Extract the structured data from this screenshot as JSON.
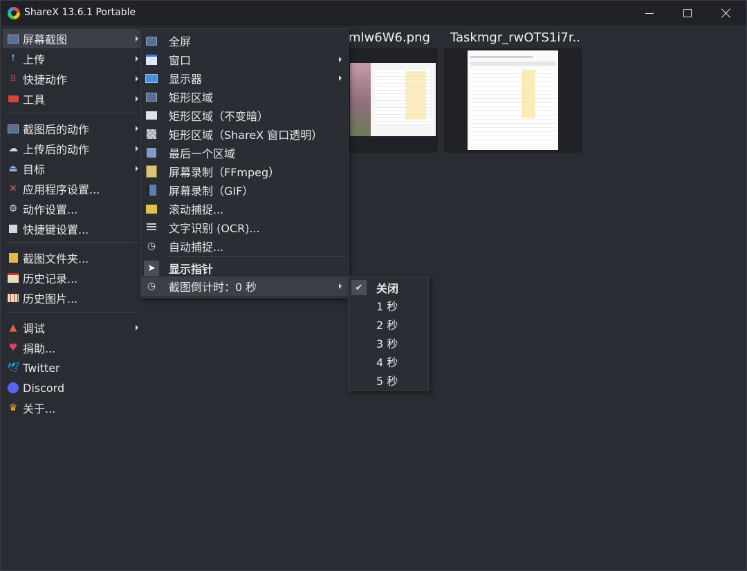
{
  "window": {
    "title": "ShareX 13.6.1 Portable"
  },
  "thumbnails": [
    {
      "title": "mlw6W6.png"
    },
    {
      "title": "Taskmgr_rwOTS1i7r..."
    }
  ],
  "main_menu": {
    "items": [
      {
        "label": "屏幕截图",
        "icon": "screenshot-icon",
        "has_submenu": true
      },
      {
        "label": "上传",
        "icon": "upload-arrow-icon",
        "has_submenu": true
      },
      {
        "label": "快捷动作",
        "icon": "quick-actions-grid-icon",
        "has_submenu": true
      },
      {
        "label": "工具",
        "icon": "toolbox-icon",
        "has_submenu": true
      },
      {
        "label": "截图后的动作",
        "icon": "after-capture-icon",
        "has_submenu": true
      },
      {
        "label": "上传后的动作",
        "icon": "cloud-upload-icon",
        "has_submenu": true
      },
      {
        "label": "目标",
        "icon": "destination-icon",
        "has_submenu": true
      },
      {
        "label": "应用程序设置...",
        "icon": "wrench-icon",
        "has_submenu": false
      },
      {
        "label": "动作设置...",
        "icon": "gear-icon",
        "has_submenu": false
      },
      {
        "label": "快捷键设置...",
        "icon": "keyboard-icon",
        "has_submenu": false
      },
      {
        "label": "截图文件夹...",
        "icon": "folder-icon",
        "has_submenu": false
      },
      {
        "label": "历史记录...",
        "icon": "history-icon",
        "has_submenu": false
      },
      {
        "label": "历史图片...",
        "icon": "image-history-icon",
        "has_submenu": false
      },
      {
        "label": "调试",
        "icon": "traffic-cone-icon",
        "has_submenu": true
      },
      {
        "label": "捐助...",
        "icon": "heart-icon",
        "has_submenu": false
      },
      {
        "label": "Twitter",
        "icon": "twitter-bird-icon",
        "has_submenu": false
      },
      {
        "label": "Discord",
        "icon": "discord-icon",
        "has_submenu": false
      },
      {
        "label": "关于...",
        "icon": "crown-icon",
        "has_submenu": false
      }
    ]
  },
  "capture_menu": {
    "items": [
      {
        "label": "全屏",
        "icon": "fullscreen-icon"
      },
      {
        "label": "窗口",
        "icon": "window-icon"
      },
      {
        "label": "显示器",
        "icon": "monitor-icon"
      },
      {
        "label": "矩形区域",
        "icon": "region-icon"
      },
      {
        "label": "矩形区域（不变暗）",
        "icon": "region-light-icon"
      },
      {
        "label": "矩形区域（ShareX 窗口透明）",
        "icon": "region-transparent-icon"
      },
      {
        "label": "最后一个区域",
        "icon": "last-region-icon"
      },
      {
        "label": "屏幕录制（FFmpeg）",
        "icon": "record-video-icon"
      },
      {
        "label": "屏幕录制（GIF）",
        "icon": "record-gif-icon"
      },
      {
        "label": "滚动捕捉...",
        "icon": "scrolling-capture-icon"
      },
      {
        "label": "文字识别 (OCR)...",
        "icon": "ocr-icon"
      },
      {
        "label": "自动捕捉...",
        "icon": "clock-icon"
      },
      {
        "label": "显示指针",
        "icon": "cursor-icon"
      },
      {
        "label": "截图倒计时：0 秒",
        "icon": "timer-clock-icon"
      }
    ]
  },
  "timer_menu": {
    "items": [
      {
        "label": "关闭",
        "checked": true
      },
      {
        "label": "1 秒",
        "checked": false
      },
      {
        "label": "2 秒",
        "checked": false
      },
      {
        "label": "3 秒",
        "checked": false
      },
      {
        "label": "4 秒",
        "checked": false
      },
      {
        "label": "5 秒",
        "checked": false
      }
    ]
  },
  "colors": {
    "background": "#2a2c33",
    "titlebar": "#202228",
    "menu": "#2b2d34",
    "highlight": "#3c3f48"
  }
}
